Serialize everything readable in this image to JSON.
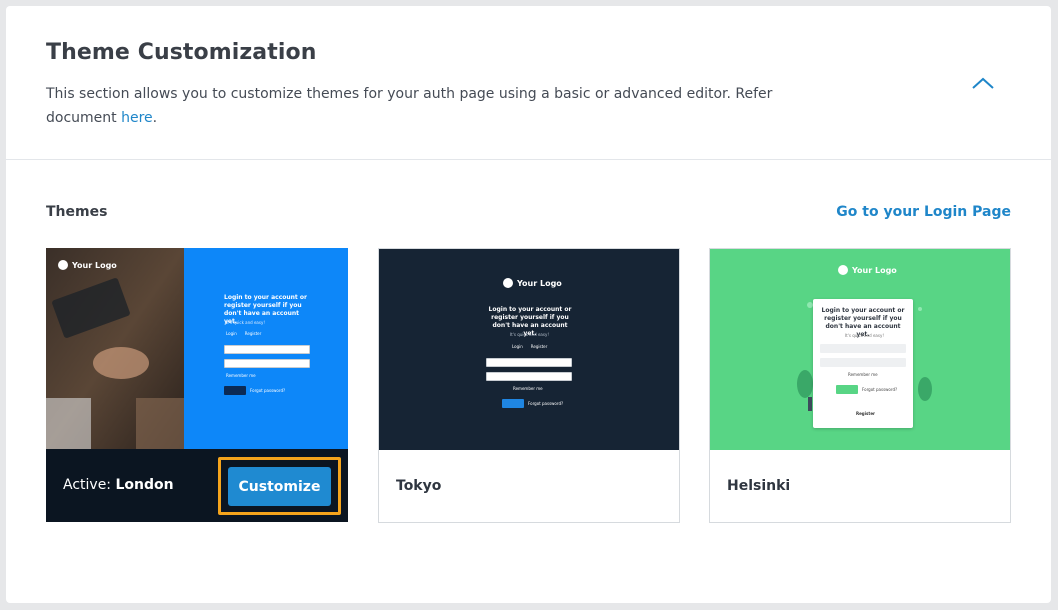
{
  "header": {
    "title": "Theme Customization",
    "description": "This section allows you to customize themes for your auth page using a basic or advanced editor. Refer document",
    "link_text": "here",
    "period": ".",
    "collapse_icon": "chevron-up-icon"
  },
  "themes_section": {
    "label": "Themes",
    "login_link": "Go to your Login Page"
  },
  "themes": [
    {
      "name": "London",
      "active_prefix": "Active:",
      "button_label": "Customize",
      "preview": {
        "logo": "Your Logo",
        "heading": "Login to your account or register yourself if you don't have an account yet.",
        "sub": "It's quick and easy!",
        "tab_login": "Login",
        "tab_register": "Register",
        "email": "Email",
        "password": "Password",
        "remember": "Remember me",
        "login_btn": "Login",
        "forgot": "Forgot password?"
      }
    },
    {
      "name": "Tokyo",
      "preview": {
        "logo": "Your Logo",
        "heading": "Login to your account or register yourself if you don't have an account yet.",
        "sub": "It's quick and easy!",
        "tab_login": "Login",
        "tab_register": "Register",
        "email": "Email",
        "password": "Password",
        "remember": "Remember me",
        "login_btn": "Login",
        "forgot": "Forgot password?"
      }
    },
    {
      "name": "Helsinki",
      "preview": {
        "logo": "Your Logo",
        "heading": "Login to your account or register yourself if you don't have an account yet.",
        "sub": "It's quick and easy!",
        "email": "Email",
        "password": "Password",
        "remember": "Remember me",
        "login_btn": "Login",
        "forgot": "Forgot password?",
        "register": "Register"
      }
    }
  ],
  "colors": {
    "accent": "#1f86c9",
    "highlight": "#f5a41c",
    "london_blue": "#0d87f9",
    "tokyo_bg": "#162434",
    "helsinki_green": "#58d585"
  }
}
